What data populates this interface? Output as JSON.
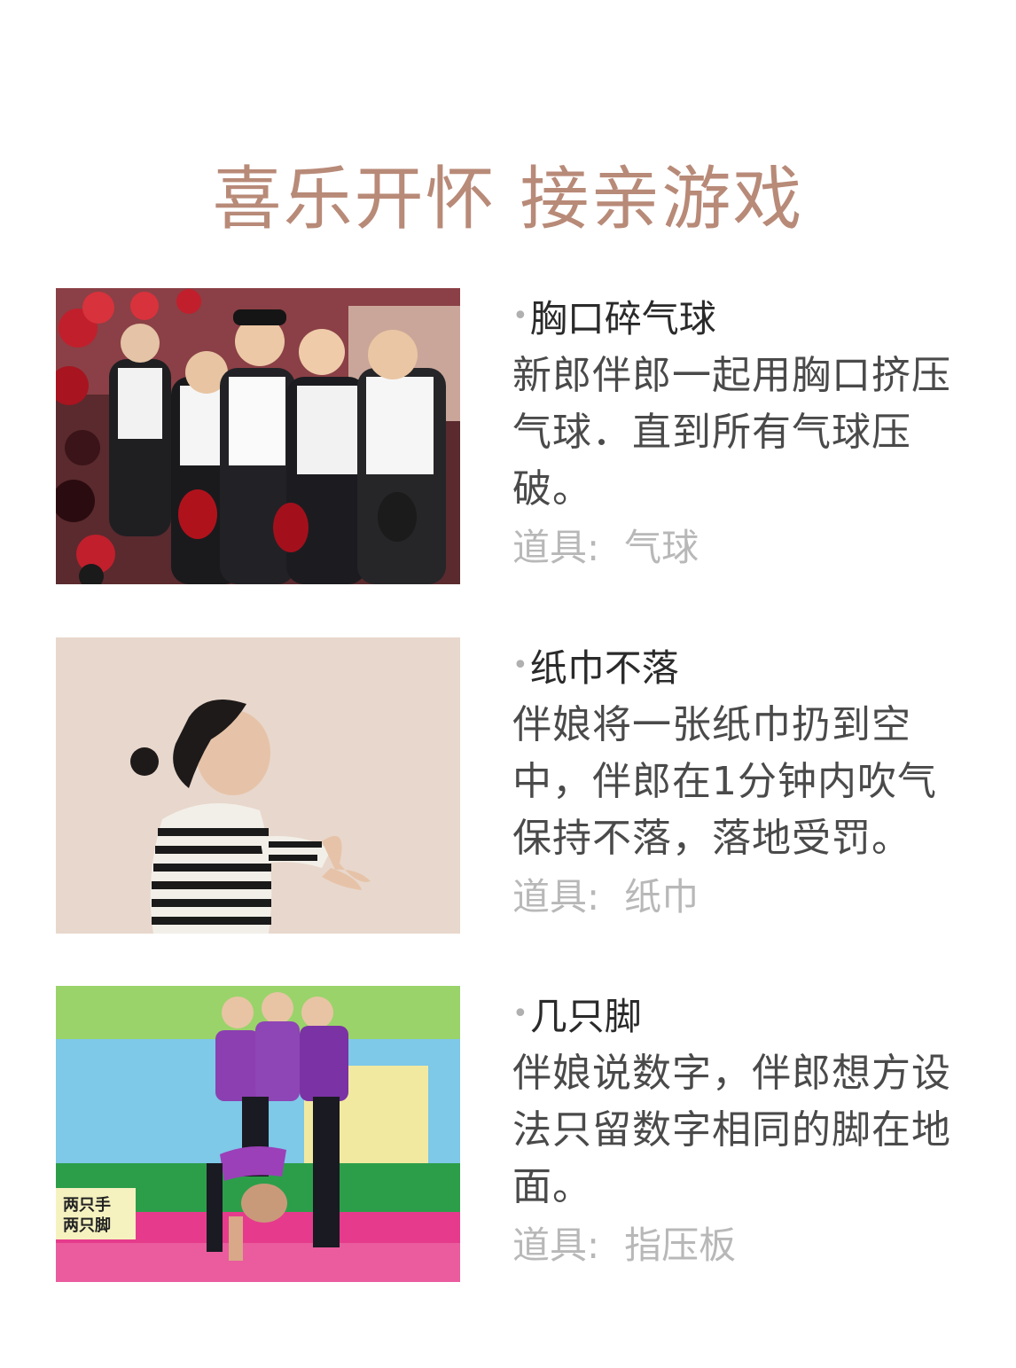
{
  "title": "喜乐开怀 接亲游戏",
  "games": [
    {
      "name": "胸口碎气球",
      "description": "新郎伴郎一起用胸口挤压气球．直到所有气球压破。",
      "prop_label": "道具:",
      "prop_value": "气球",
      "photo_icon": "photo-groomsmen-balloons"
    },
    {
      "name": "纸巾不落",
      "description": "伴娘将一张纸巾扔到空中，伴郎在1分钟内吹气保持不落，落地受罚。",
      "prop_label": "道具:",
      "prop_value": "纸巾",
      "photo_icon": "photo-woman-blowing"
    },
    {
      "name": "几只脚",
      "description": "伴娘说数字，伴郎想方设法只留数字相同的脚在地面。",
      "prop_label": "道具:",
      "prop_value": "指压板",
      "photo_icon": "photo-tv-show-game",
      "photo_caption_line1": "两只手",
      "photo_caption_line2": "两只脚"
    }
  ],
  "bullet": "•",
  "colors": {
    "title": "#b88a78",
    "name": "#2a2a2a",
    "desc": "#4a4a4a",
    "prop": "#b8b8b8"
  }
}
